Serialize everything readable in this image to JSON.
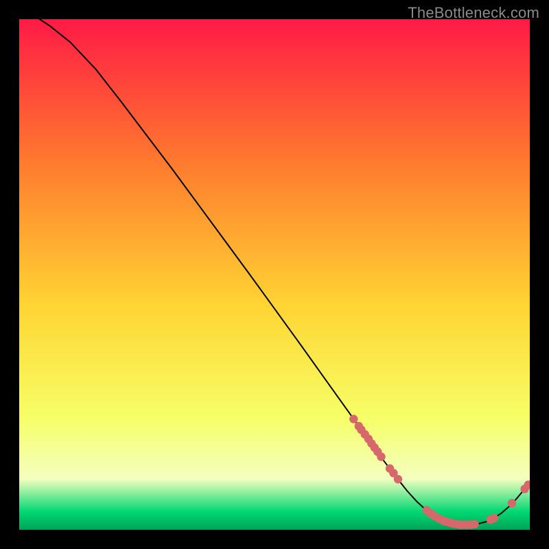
{
  "watermark": "TheBottleneck.com",
  "colors": {
    "pointFill": "#d6676b",
    "pointStroke": "#b94e52",
    "lineColor": "#000000",
    "gradientTop": "#ff1a45",
    "gradientMidHigh": "#ff7a2e",
    "gradientMid": "#ffd433",
    "gradientMidLow": "#f6ff66",
    "gradientPale": "#f4ffc0",
    "gradientGreen": "#00d772",
    "gradientGreenDark": "#00a357"
  },
  "chart_data": {
    "type": "line",
    "title": "",
    "xlabel": "",
    "ylabel": "",
    "xlim": [
      0,
      100
    ],
    "ylim": [
      0,
      100
    ],
    "series": [
      {
        "name": "curve",
        "x": [
          4,
          6,
          10,
          15,
          20,
          25,
          30,
          35,
          40,
          45,
          50,
          55,
          60,
          65,
          68,
          70,
          73,
          76,
          78,
          80,
          82,
          84,
          86,
          88,
          90,
          91.5,
          93,
          94.5,
          96,
          97.5,
          99.5
        ],
        "y": [
          100,
          98.7,
          95.5,
          90.2,
          83.8,
          77.2,
          70.6,
          63.8,
          57.0,
          50.2,
          43.3,
          36.4,
          29.4,
          22.4,
          18.2,
          15.4,
          11.4,
          7.6,
          5.4,
          3.6,
          2.3,
          1.5,
          1.1,
          1.0,
          1.2,
          1.6,
          2.3,
          3.3,
          4.6,
          6.2,
          8.6
        ]
      }
    ],
    "points": {
      "name": "points",
      "x": [
        65.5,
        66.5,
        67.0,
        67.7,
        68.4,
        69.0,
        69.6,
        70.2,
        70.9,
        72.6,
        73.3,
        74.2,
        79.8,
        80.6,
        81.3,
        82.2,
        83.0,
        83.6,
        84.3,
        85.0,
        85.7,
        86.3,
        87.0,
        87.7,
        88.5,
        89.2,
        92.3,
        93.0,
        96.5,
        99.0,
        99.7
      ],
      "y": [
        21.7,
        20.3,
        19.6,
        18.7,
        17.8,
        16.9,
        16.1,
        15.3,
        14.3,
        12.0,
        11.1,
        9.9,
        3.8,
        3.2,
        2.7,
        2.2,
        1.8,
        1.6,
        1.4,
        1.2,
        1.1,
        1.0,
        1.0,
        1.0,
        1.0,
        1.1,
        2.0,
        2.3,
        5.2,
        8.0,
        8.8
      ]
    }
  }
}
